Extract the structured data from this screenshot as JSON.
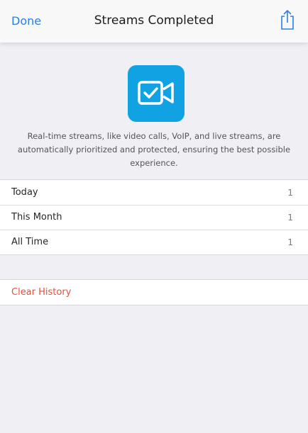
{
  "navbar": {
    "done_label": "Done",
    "title": "Streams Completed",
    "share_icon": "share-icon"
  },
  "hero": {
    "icon": "video-check-icon",
    "icon_background": "#11a2e4",
    "description": "Real-time streams, like video calls, VoIP, and live streams, are automatically prioritized and protected, ensuring the best possible experience."
  },
  "stats": [
    {
      "label": "Today",
      "value": "1"
    },
    {
      "label": "This Month",
      "value": "1"
    },
    {
      "label": "All Time",
      "value": "1"
    }
  ],
  "actions": {
    "clear_history_label": "Clear History"
  },
  "colors": {
    "accent": "#2f7ee2",
    "destructive": "#e5503f",
    "background": "#efeff4"
  }
}
